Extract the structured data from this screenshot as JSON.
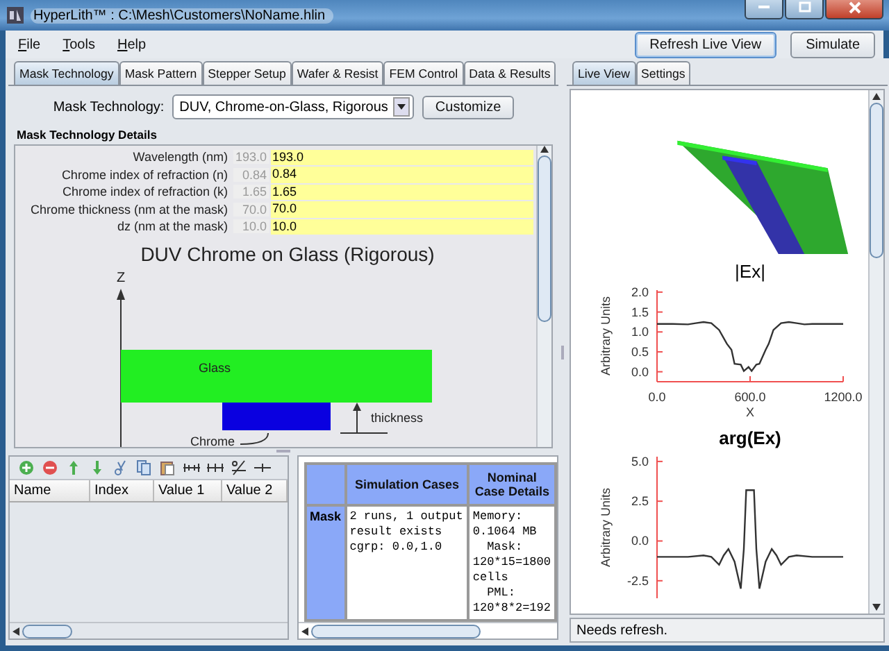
{
  "window": {
    "title": "HyperLith™ : C:\\Mesh\\Customers\\NoName.hlin"
  },
  "menu": [
    "File",
    "Tools",
    "Help"
  ],
  "toolbar_buttons": [
    "Refresh Live View",
    "Simulate"
  ],
  "tabs": [
    {
      "label": "Mask Technology",
      "selected": true
    },
    {
      "label": "Mask Pattern",
      "selected": false
    },
    {
      "label": "Stepper Setup",
      "selected": false
    },
    {
      "label": "Wafer & Resist",
      "selected": false
    },
    {
      "label": "FEM Control",
      "selected": false
    },
    {
      "label": "Data & Results",
      "selected": false
    }
  ],
  "mask_technology": {
    "label": "Mask Technology:",
    "value": "DUV, Chrome-on-Glass, Rigorous",
    "button": "Customize"
  },
  "details": {
    "title": "Mask Technology Details",
    "rows": [
      {
        "label": "Wavelength (nm)",
        "default": "193.0",
        "value": "193.0"
      },
      {
        "label": "Chrome index of refraction (n)",
        "default": "0.84",
        "value": "0.84"
      },
      {
        "label": "Chrome index of refraction (k)",
        "default": "1.65",
        "value": "1.65"
      },
      {
        "label": "Chrome thickness (nm at the mask)",
        "default": "70.0",
        "value": "70.0"
      },
      {
        "label": "dz (nm at the mask)",
        "default": "10.0",
        "value": "10.0"
      }
    ]
  },
  "diagram": {
    "title": "DUV Chrome on Glass (Rigorous)",
    "axis_label": "Z",
    "glass_label": "Glass",
    "thickness_label": "thickness",
    "chrome_label": "Chrome"
  },
  "parameter_table": {
    "columns": [
      "Name",
      "Index",
      "Value 1",
      "Value 2"
    ]
  },
  "results_table": {
    "columns": [
      "Simulation Cases",
      "Nominal Case Details"
    ],
    "rows": [
      {
        "header": "Mask",
        "cells": [
          [
            "2 runs, 1 output",
            "result exists",
            "cgrp: 0.0,1.0"
          ],
          [
            "Memory:",
            "0.1064 MB",
            "  Mask:",
            "120*15=1800",
            "cells",
            "  PML:",
            "120*8*2=192"
          ]
        ]
      }
    ]
  },
  "right_tabs": [
    {
      "label": "Live View",
      "selected": true
    },
    {
      "label": "Settings",
      "selected": false
    }
  ],
  "charts": [
    {
      "chart_data": {
        "type": "line",
        "title": "|Ex|",
        "xlabel": "X",
        "ylabel": "Arbitrary Units",
        "xlim": [
          0,
          1200
        ],
        "ylim": [
          -0.25,
          2.05
        ],
        "xticks": [
          {
            "value": 0,
            "label": "0.0"
          },
          {
            "value": 600,
            "label": "600.0"
          },
          {
            "value": 1200,
            "label": "1200.0"
          }
        ],
        "yticks": [
          {
            "value": 0,
            "label": "0.0"
          },
          {
            "value": 0.5,
            "label": "0.5"
          },
          {
            "value": 1,
            "label": "1.0"
          },
          {
            "value": 1.5,
            "label": "1.5"
          },
          {
            "value": 2,
            "label": "2.0"
          }
        ],
        "x": [
          0,
          100,
          200,
          250,
          300,
          350,
          400,
          450,
          480,
          500,
          540,
          560,
          590,
          610,
          640,
          660,
          700,
          720,
          750,
          800,
          850,
          900,
          950,
          1000,
          1100,
          1200
        ],
        "series": [
          {
            "color": "#333333",
            "values": [
              1.2,
              1.2,
              1.19,
              1.22,
              1.25,
              1.22,
              1.05,
              0.7,
              0.55,
              0.2,
              0.18,
              0.02,
              0.12,
              0.02,
              0.18,
              0.2,
              0.55,
              0.7,
              1.05,
              1.22,
              1.25,
              1.22,
              1.19,
              1.2,
              1.2,
              1.2
            ]
          }
        ]
      }
    },
    {
      "chart_data": {
        "type": "line",
        "title": "arg(Ex)",
        "ylabel": "Arbitrary Units",
        "xlim": [
          0,
          1200
        ],
        "ylim": [
          -3.6,
          5.3
        ],
        "yticks": [
          {
            "value": -2.5,
            "label": "-2.5"
          },
          {
            "value": 0,
            "label": "0.0"
          },
          {
            "value": 2.5,
            "label": "2.5"
          },
          {
            "value": 5,
            "label": "5.0"
          }
        ],
        "x": [
          0,
          200,
          300,
          350,
          400,
          430,
          460,
          500,
          540,
          560,
          575,
          590,
          610,
          625,
          640,
          660,
          700,
          740,
          770,
          800,
          850,
          900,
          1000,
          1200
        ],
        "series": [
          {
            "color": "#333333",
            "values": [
              -1,
              -1,
              -0.9,
              -1,
              -1.5,
              -0.9,
              -0.5,
              -1.3,
              -3.0,
              -0.5,
              3.2,
              3.2,
              3.2,
              3.2,
              -0.5,
              -3.0,
              -1.3,
              -0.5,
              -0.9,
              -1.5,
              -1,
              -0.9,
              -1,
              -1
            ]
          }
        ]
      }
    }
  ],
  "status_bar": "Needs refresh."
}
